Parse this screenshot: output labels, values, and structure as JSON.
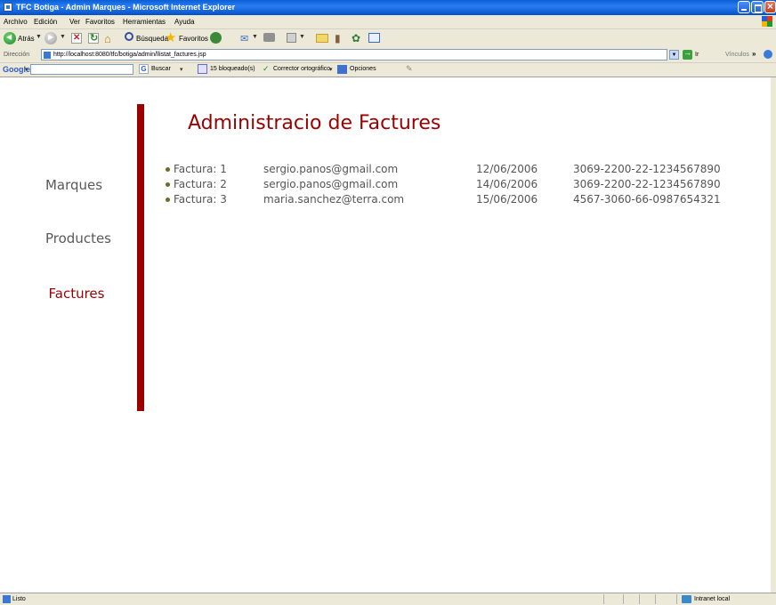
{
  "window": {
    "title": "TFC Botiga - Admin Marques - Microsoft Internet Explorer"
  },
  "menu": [
    "Archivo",
    "Edición",
    "Ver",
    "Favoritos",
    "Herramientas",
    "Ayuda"
  ],
  "toolbar": {
    "back_label": "Atrás",
    "search_label": "Búsqueda",
    "favorites_label": "Favoritos"
  },
  "address": {
    "label": "Dirección",
    "url": "http://localhost:8080/tfc/botiga/admin/llistat_factures.jsp",
    "go_label": "Ir",
    "links_label": "Vínculos"
  },
  "google_bar": {
    "logo": "Google",
    "search_label": "Buscar",
    "blocked_label": "15 bloqueado(s)",
    "spell_label": "Corrector ortográfico",
    "options_label": "Opciones"
  },
  "sidebar": {
    "items": [
      {
        "label": "Marques",
        "active": false
      },
      {
        "label": "Productes",
        "active": false
      },
      {
        "label": "Factures",
        "active": true
      }
    ]
  },
  "main": {
    "title": "Administracio de Factures",
    "invoices": [
      {
        "label": "Factura: 1",
        "email": "sergio.panos@gmail.com",
        "date": "12/06/2006",
        "account": "3069-2200-22-1234567890"
      },
      {
        "label": "Factura: 2",
        "email": "sergio.panos@gmail.com",
        "date": "14/06/2006",
        "account": "3069-2200-22-1234567890"
      },
      {
        "label": "Factura: 3",
        "email": "maria.sanchez@terra.com",
        "date": "15/06/2006",
        "account": "4567-3060-66-0987654321"
      }
    ]
  },
  "status": {
    "text": "Listo",
    "zone": "Intranet local"
  },
  "colors": {
    "accent": "#9b0000",
    "text": "#595959",
    "xp_title": "#0a5fd6",
    "chrome": "#ece9d8"
  }
}
